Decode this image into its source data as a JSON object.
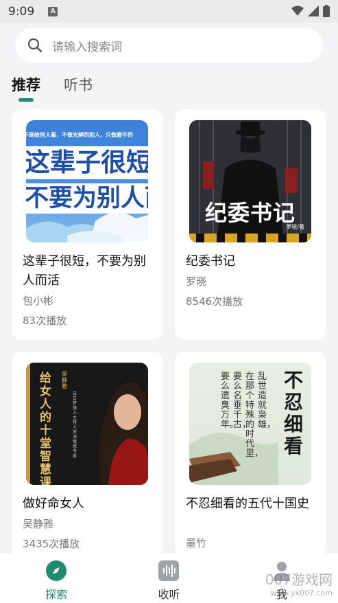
{
  "status_bar": {
    "time": "9:09",
    "a_badge": "A"
  },
  "search": {
    "placeholder": "请输入搜索词"
  },
  "tabs": [
    {
      "label": "推荐",
      "active": true
    },
    {
      "label": "听书",
      "active": false
    }
  ],
  "books": [
    {
      "title": "这辈子很短，不要为别人而活",
      "author": "包小彬",
      "plays": "83次播放",
      "cover_text_top": "不是给别人看，不做光鲜的别人，只做最牛的",
      "cover_line1": "这辈子很短",
      "cover_line2": "不要为别人而"
    },
    {
      "title": "纪委书记",
      "author": "罗晓",
      "plays": "8546次播放",
      "cover_title": "纪委书记",
      "cover_author": "罗晓/著"
    },
    {
      "title": "做好命女人",
      "author": "吴静雅",
      "plays": "3435次播放",
      "cover_title": "给女人的十堂智慧课",
      "cover_sub": "吴静雅",
      "cover_sub2": "白日梦镇人·主持人·资深情感专家"
    },
    {
      "title": "不忍细看的五代十国史",
      "author": "墨竹",
      "plays": "",
      "cover_title": "不忍细看",
      "cover_poem": [
        "乱世造就枭雄，",
        "在那个特殊的时代里，",
        "要么名垂千古，",
        "要么遗臭万年。"
      ]
    }
  ],
  "bottom_nav": [
    {
      "label": "探索",
      "icon": "compass-icon",
      "active": true
    },
    {
      "label": "收听",
      "icon": "audio-wave-icon",
      "active": false
    },
    {
      "label": "我",
      "icon": "person-icon",
      "active": false
    }
  ],
  "watermark": {
    "main": "007游戏网",
    "sub": "www.yx007.com"
  },
  "colors": {
    "accent": "#1f8d6d",
    "background": "#f3f4f5",
    "card": "#ffffff"
  }
}
